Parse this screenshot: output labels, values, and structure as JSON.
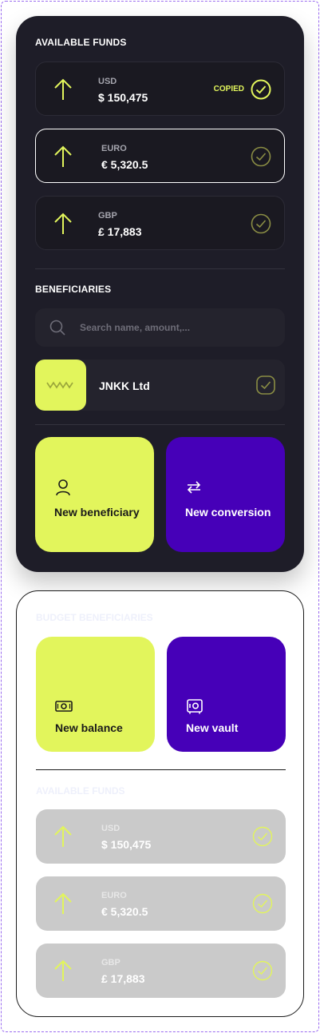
{
  "available_funds": {
    "title": "AVAILABLE FUNDS",
    "copied_label": "COPIED",
    "items": [
      {
        "currency": "USD",
        "amount": "$ 150,475"
      },
      {
        "currency": "EURO",
        "amount": "€ 5,320.5"
      },
      {
        "currency": "GBP",
        "amount": "£ 17,883"
      }
    ]
  },
  "beneficiaries": {
    "title": "BENEFICIARIES",
    "search_placeholder": "Search name, amount,...",
    "items": [
      {
        "name": "JNKK Ltd"
      }
    ]
  },
  "actions_dark": [
    {
      "label": "New beneficiary",
      "icon": "user-icon"
    },
    {
      "label": "New conversion",
      "icon": "convert-arrows-icon"
    }
  ],
  "light_card": {
    "top_title": "BUDGET BENEFICIARIES",
    "actions": [
      {
        "label": "New balance",
        "icon": "banknote-icon"
      },
      {
        "label": "New vault",
        "icon": "vault-icon"
      }
    ],
    "funds_title": "AVAILABLE FUNDS",
    "items": [
      {
        "currency": "USD",
        "amount": "$ 150,475"
      },
      {
        "currency": "EURO",
        "amount": "€ 5,320.5"
      },
      {
        "currency": "GBP",
        "amount": "£ 17,883"
      }
    ]
  },
  "colors": {
    "dark_bg": "#1e1d28",
    "lime": "#e2f55c",
    "purple": "#4600b8",
    "ghost_gray": "#cacaca"
  }
}
